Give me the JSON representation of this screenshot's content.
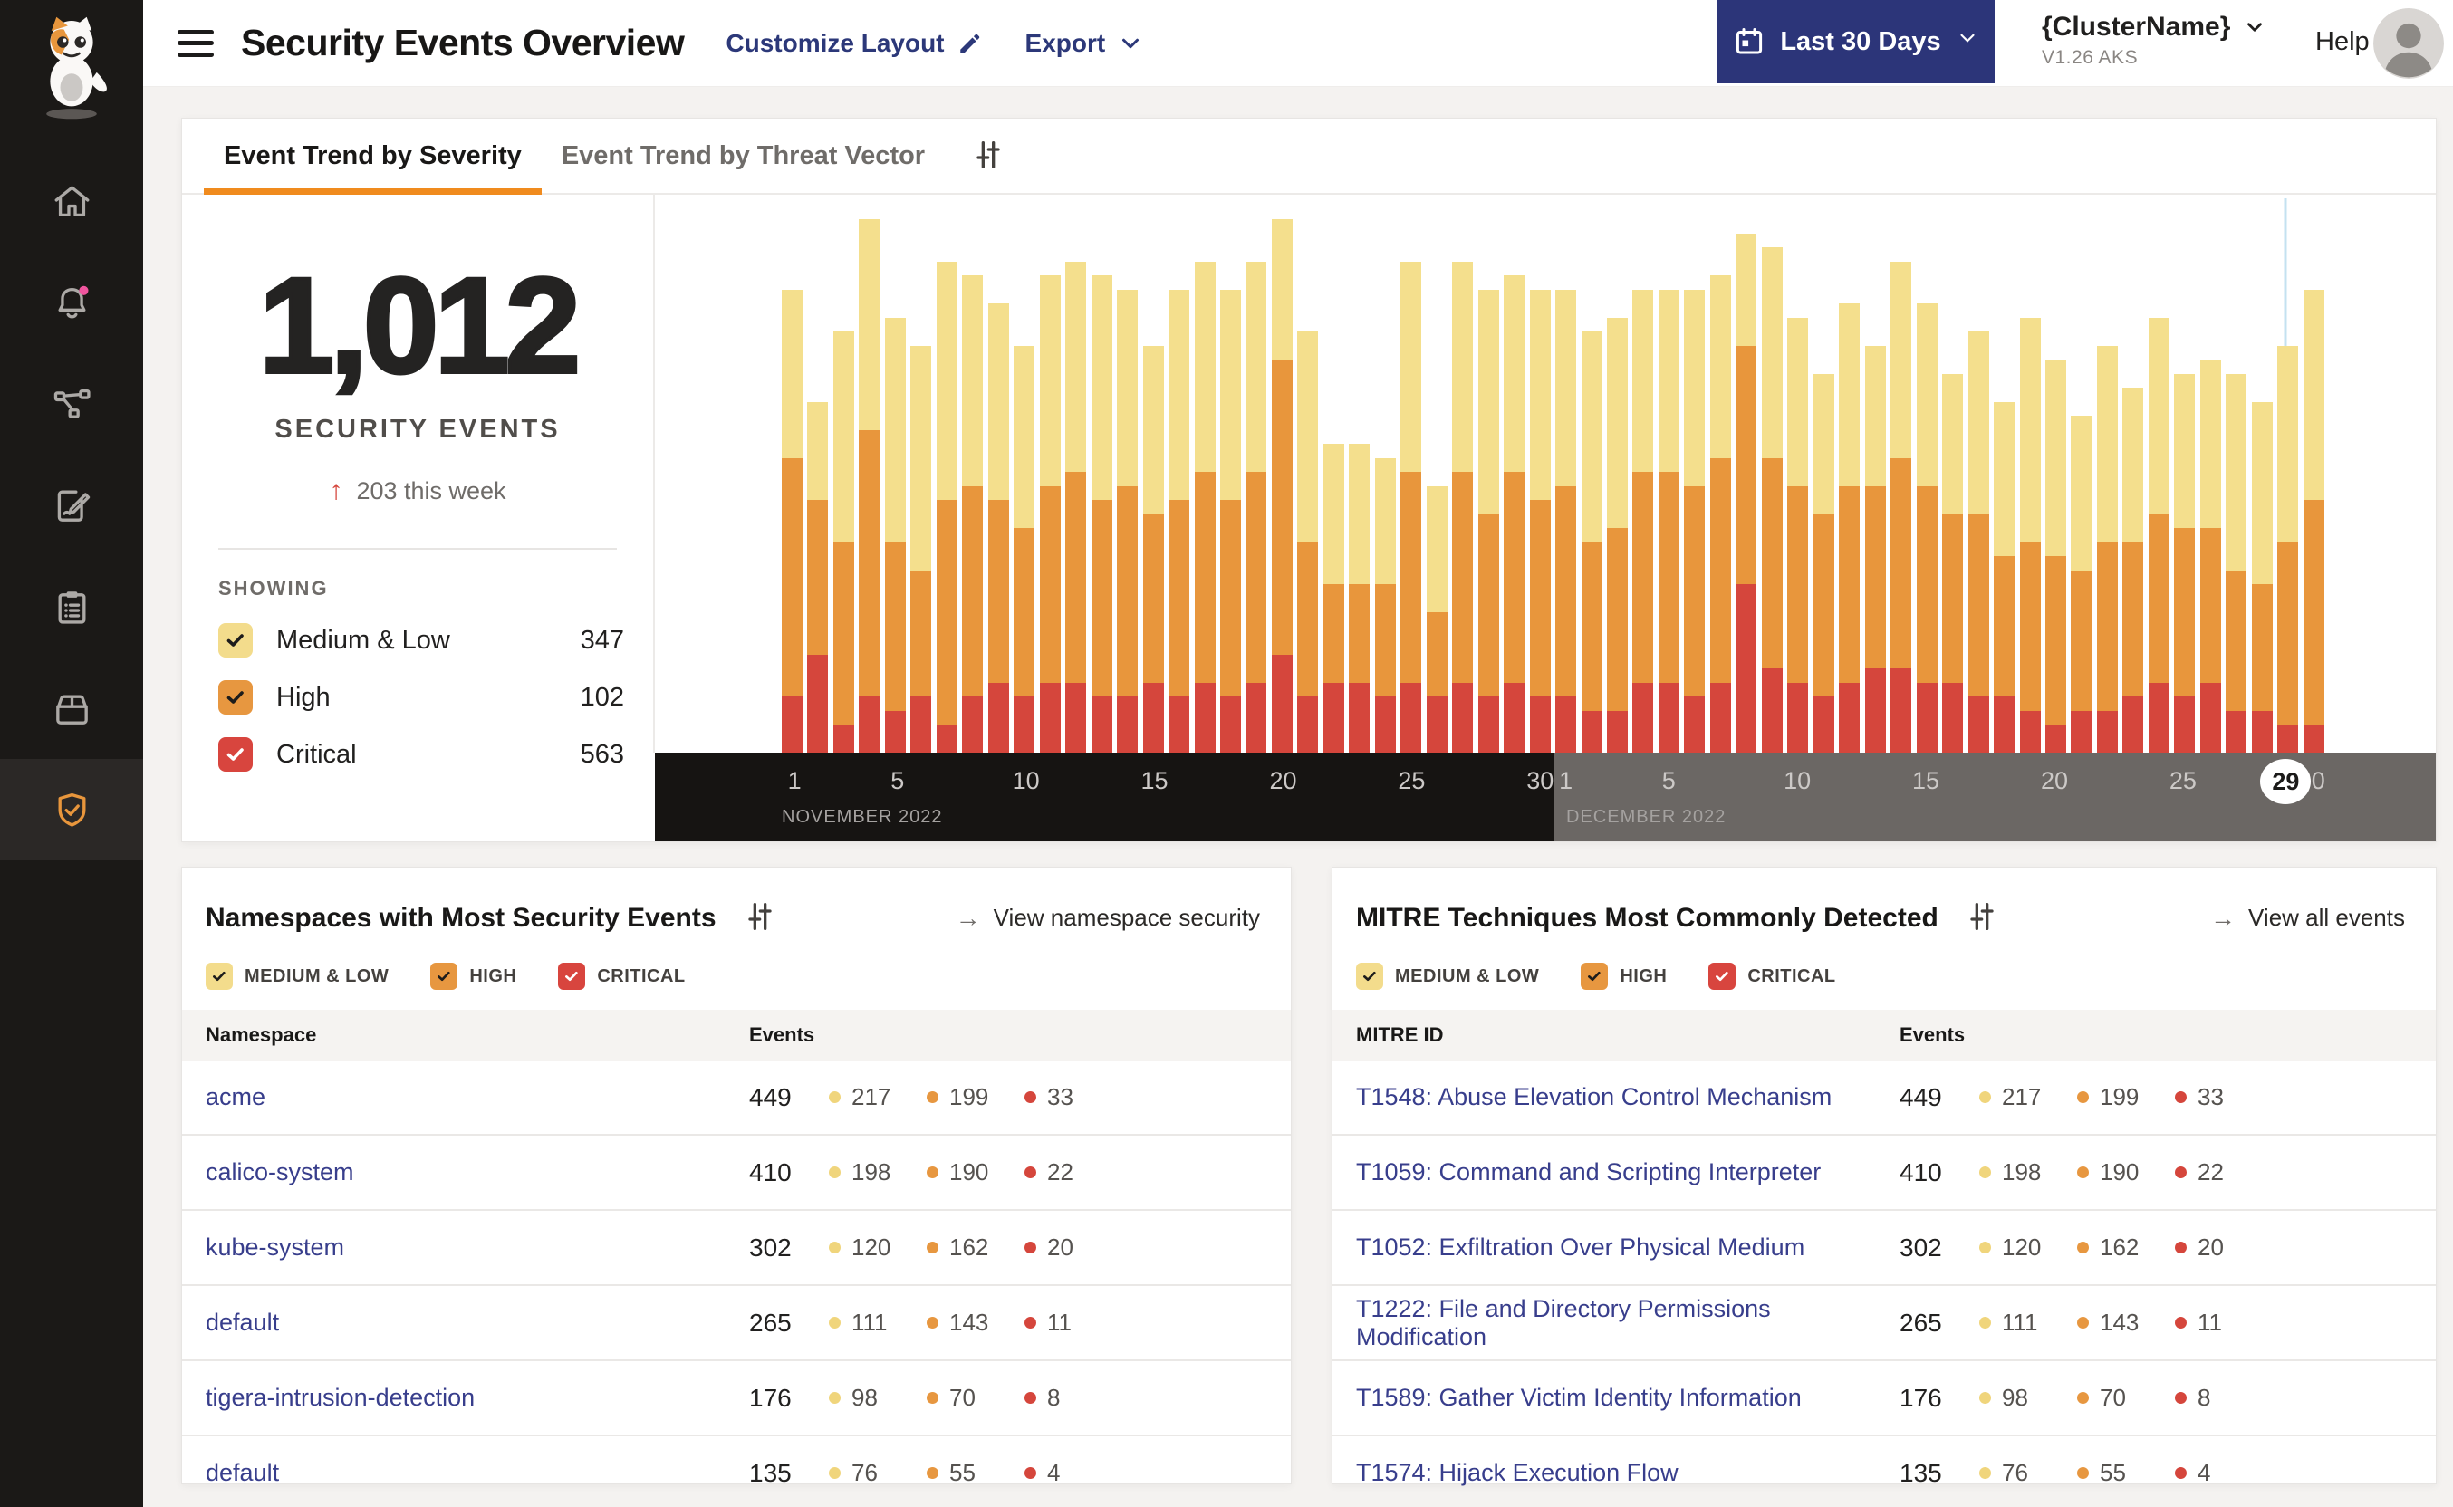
{
  "icons": {
    "up_arrow": "↑",
    "arrow_right": "→"
  },
  "colors": {
    "accent_orange": "#F08B1E",
    "severity_medium_low": "#F4DF8D",
    "severity_high": "#E8963C",
    "severity_critical": "#D5463C",
    "link_indigo": "#383E8C",
    "navy_button": "#2C3579",
    "badge_pink": "#F0559E"
  },
  "header": {
    "title": "Security Events Overview",
    "customize_layout": "Customize Layout",
    "export_label": "Export",
    "date_range": "Last 30 Days",
    "cluster_name": "{ClusterName}",
    "cluster_version": "V1.26 AKS",
    "help": "Help"
  },
  "sidebar": {
    "items": [
      {
        "icon": "home-icon"
      },
      {
        "icon": "alerts-bell-icon",
        "badge": true
      },
      {
        "icon": "service-graph-icon"
      },
      {
        "icon": "policies-edit-icon"
      },
      {
        "icon": "compliance-clipboard-icon"
      },
      {
        "icon": "image-assurance-box-icon"
      },
      {
        "icon": "threat-defense-shield-icon",
        "active": true
      }
    ]
  },
  "trend_card": {
    "tabs": [
      {
        "label": "Event Trend by Severity",
        "active": true
      },
      {
        "label": "Event Trend by Threat Vector",
        "active": false
      }
    ],
    "summary": {
      "total": "1,012",
      "label": "SECURITY EVENTS",
      "delta": "203 this week"
    },
    "showing": {
      "label": "SHOWING",
      "items": [
        {
          "label": "Medium & Low",
          "value": "347"
        },
        {
          "label": "High",
          "value": "102"
        },
        {
          "label": "Critical",
          "value": "563"
        }
      ]
    }
  },
  "chart_data": {
    "type": "bar",
    "stacked": true,
    "title": "Event Trend by Severity",
    "x_unit": "day",
    "ylim": [
      0,
      40
    ],
    "grid": false,
    "months": [
      {
        "label": "NOVEMBER 2022",
        "offset": 0,
        "days": 30,
        "ticks": [
          1,
          5,
          10,
          15,
          20,
          25,
          30
        ]
      },
      {
        "label": "DECEMBER 2022",
        "offset": 30,
        "days": 30,
        "ticks": [
          1,
          5,
          10,
          15,
          20,
          25,
          30
        ]
      }
    ],
    "marker": {
      "month": "DECEMBER 2022",
      "day": 29,
      "index": 58,
      "day_label": "29"
    },
    "series": [
      {
        "name": "Critical",
        "color": "#D5463C",
        "values": [
          4,
          7,
          2,
          4,
          3,
          4,
          2,
          4,
          5,
          4,
          5,
          5,
          4,
          4,
          5,
          4,
          5,
          4,
          5,
          7,
          4,
          5,
          5,
          4,
          5,
          4,
          5,
          4,
          5,
          4,
          4,
          3,
          3,
          5,
          5,
          4,
          5,
          12,
          6,
          5,
          4,
          5,
          6,
          6,
          5,
          5,
          4,
          4,
          3,
          2,
          3,
          3,
          4,
          5,
          4,
          5,
          3,
          3,
          2,
          2
        ]
      },
      {
        "name": "High",
        "color": "#E8963C",
        "values": [
          17,
          11,
          13,
          19,
          12,
          9,
          16,
          15,
          13,
          12,
          14,
          15,
          14,
          15,
          12,
          14,
          15,
          14,
          15,
          21,
          11,
          7,
          7,
          8,
          15,
          6,
          15,
          13,
          15,
          14,
          15,
          12,
          13,
          15,
          15,
          15,
          16,
          17,
          15,
          14,
          13,
          14,
          13,
          15,
          14,
          12,
          13,
          10,
          12,
          12,
          10,
          12,
          11,
          12,
          12,
          11,
          10,
          9,
          13,
          16
        ]
      },
      {
        "name": "Medium & Low",
        "color": "#F4DF8D",
        "values": [
          12,
          7,
          15,
          15,
          16,
          16,
          17,
          15,
          14,
          13,
          15,
          15,
          16,
          14,
          12,
          15,
          15,
          15,
          15,
          10,
          15,
          10,
          10,
          9,
          15,
          9,
          15,
          16,
          14,
          15,
          14,
          15,
          15,
          13,
          13,
          14,
          13,
          8,
          15,
          12,
          10,
          13,
          10,
          14,
          13,
          10,
          13,
          11,
          16,
          14,
          11,
          14,
          11,
          14,
          11,
          12,
          14,
          13,
          14,
          15
        ]
      }
    ]
  },
  "severity_filters": {
    "medium_low": "MEDIUM & LOW",
    "high": "HIGH",
    "critical": "CRITICAL"
  },
  "namespaces_card": {
    "title": "Namespaces with Most Security Events",
    "link": "View namespace security",
    "columns": {
      "name": "Namespace",
      "events": "Events"
    },
    "rows": [
      {
        "name": "acme",
        "total": "449",
        "medium_low": "217",
        "high": "199",
        "critical": "33"
      },
      {
        "name": "calico-system",
        "total": "410",
        "medium_low": "198",
        "high": "190",
        "critical": "22"
      },
      {
        "name": "kube-system",
        "total": "302",
        "medium_low": "120",
        "high": "162",
        "critical": "20"
      },
      {
        "name": "default",
        "total": "265",
        "medium_low": "111",
        "high": "143",
        "critical": "11"
      },
      {
        "name": "tigera-intrusion-detection",
        "total": "176",
        "medium_low": "98",
        "high": "70",
        "critical": "8"
      },
      {
        "name": "default",
        "total": "135",
        "medium_low": "76",
        "high": "55",
        "critical": "4"
      }
    ]
  },
  "mitre_card": {
    "title": "MITRE Techniques Most Commonly Detected",
    "link": "View all events",
    "columns": {
      "name": "MITRE ID",
      "events": "Events"
    },
    "rows": [
      {
        "name": "T1548: Abuse Elevation Control Mechanism",
        "total": "449",
        "medium_low": "217",
        "high": "199",
        "critical": "33"
      },
      {
        "name": "T1059: Command and Scripting Interpreter",
        "total": "410",
        "medium_low": "198",
        "high": "190",
        "critical": "22"
      },
      {
        "name": "T1052: Exfiltration Over Physical Medium",
        "total": "302",
        "medium_low": "120",
        "high": "162",
        "critical": "20"
      },
      {
        "name": "T1222: File and Directory Permissions Modification",
        "total": "265",
        "medium_low": "111",
        "high": "143",
        "critical": "11"
      },
      {
        "name": "T1589: Gather Victim Identity Information",
        "total": "176",
        "medium_low": "98",
        "high": "70",
        "critical": "8"
      },
      {
        "name": "T1574: Hijack Execution Flow",
        "total": "135",
        "medium_low": "76",
        "high": "55",
        "critical": "4"
      }
    ]
  }
}
